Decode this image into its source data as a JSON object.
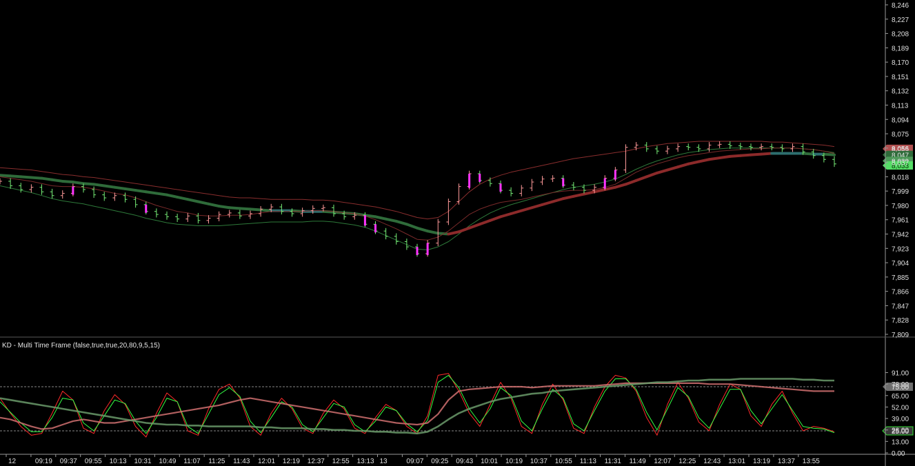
{
  "chart_data": {
    "type": "line",
    "price_panel": {
      "y_ticks": [
        "8,246",
        "8,227",
        "8,208",
        "8,189",
        "8,170",
        "8,151",
        "8,132",
        "8,113",
        "8,094",
        "8,075",
        "8,056",
        "8,037",
        "8,018",
        "7,999",
        "7,980",
        "7,961",
        "7,942",
        "7,923",
        "7,904",
        "7,885",
        "7,866",
        "7,847",
        "7,828",
        "7,809"
      ],
      "ylim": [
        7809,
        8246
      ],
      "last_labels": [
        {
          "text": "8,055",
          "value": 8055,
          "color": "#b05050"
        },
        {
          "text": "8,047",
          "value": 8047,
          "color": "#2f6b3a"
        },
        {
          "text": "8,039",
          "value": 8039,
          "color": "#4e9a5a"
        },
        {
          "text": "8,033",
          "value": 8033,
          "color": "#55dd66"
        }
      ],
      "price_series": [
        8012,
        8006,
        8001,
        8004,
        7998,
        7993,
        7996,
        8005,
        8001,
        7994,
        7990,
        7993,
        7988,
        7981,
        7972,
        7968,
        7965,
        7962,
        7966,
        7960,
        7963,
        7968,
        7970,
        7966,
        7969,
        7975,
        7978,
        7972,
        7969,
        7973,
        7976,
        7977,
        7969,
        7965,
        7967,
        7955,
        7946,
        7939,
        7932,
        7925,
        7916,
        7930,
        7958,
        7985,
        8005,
        8022,
        8013,
        8009,
        8000,
        7996,
        8003,
        8011,
        8015,
        8016,
        8007,
        8004,
        8000,
        8004,
        8016,
        8027,
        8057,
        8060,
        8055,
        8052,
        8055,
        8058,
        8057,
        8055,
        8060,
        8061,
        8059,
        8058,
        8057,
        8058,
        8057,
        8055,
        8058,
        8051,
        8046,
        8041,
        8035
      ],
      "ema_fast": [
        8018,
        8016,
        8014,
        8012,
        8009,
        8006,
        8005,
        8005,
        8004,
        8002,
        7999,
        7996,
        7994,
        7990,
        7985,
        7980,
        7976,
        7972,
        7970,
        7967,
        7966,
        7966,
        7967,
        7967,
        7968,
        7970,
        7972,
        7972,
        7972,
        7972,
        7973,
        7973,
        7972,
        7970,
        7969,
        7966,
        7961,
        7955,
        7949,
        7942,
        7935,
        7934,
        7938,
        7946,
        7957,
        7968,
        7975,
        7980,
        7984,
        7986,
        7988,
        7991,
        7994,
        7997,
        7999,
        8000,
        8000,
        8001,
        8004,
        8008,
        8016,
        8024,
        8030,
        8035,
        8039,
        8043,
        8046,
        8048,
        8050,
        8052,
        8053,
        8054,
        8055,
        8055,
        8056,
        8056,
        8056,
        8055,
        8054,
        8052,
        8049
      ],
      "ema_slow": [
        8020,
        8019,
        8018,
        8017,
        8016,
        8014,
        8012,
        8011,
        8009,
        8008,
        8006,
        8004,
        8002,
        8000,
        7998,
        7996,
        7994,
        7991,
        7988,
        7985,
        7982,
        7979,
        7977,
        7976,
        7975,
        7974,
        7973,
        7973,
        7973,
        7972,
        7972,
        7972,
        7971,
        7970,
        7969,
        7967,
        7965,
        7962,
        7959,
        7955,
        7950,
        7946,
        7943,
        7942,
        7945,
        7950,
        7955,
        7960,
        7965,
        7969,
        7973,
        7977,
        7981,
        7985,
        7989,
        7992,
        7995,
        7998,
        8001,
        8004,
        8008,
        8013,
        8018,
        8023,
        8027,
        8031,
        8035,
        8038,
        8041,
        8043,
        8045,
        8046,
        8047,
        8048,
        8049,
        8049,
        8049,
        8049,
        8048,
        8048,
        8047
      ],
      "upper_band": [
        8030,
        8029,
        8028,
        8027,
        8025,
        8023,
        8021,
        8020,
        8018,
        8017,
        8015,
        8013,
        8011,
        8009,
        8007,
        8005,
        8003,
        8001,
        7999,
        7997,
        7995,
        7993,
        7991,
        7990,
        7990,
        7989,
        7988,
        7988,
        7988,
        7988,
        7987,
        7987,
        7986,
        7984,
        7982,
        7980,
        7978,
        7975,
        7972,
        7968,
        7964,
        7962,
        7964,
        7972,
        7985,
        7998,
        8008,
        8015,
        8020,
        8024,
        8027,
        8030,
        8033,
        8036,
        8039,
        8042,
        8044,
        8046,
        8048,
        8050,
        8052,
        8055,
        8058,
        8060,
        8062,
        8063,
        8064,
        8065,
        8065,
        8065,
        8065,
        8065,
        8065,
        8065,
        8064,
        8064,
        8063,
        8062,
        8061,
        8060,
        8058
      ],
      "lower_band": [
        8006,
        8003,
        8000,
        7997,
        7993,
        7989,
        7986,
        7984,
        7982,
        7979,
        7976,
        7973,
        7970,
        7967,
        7963,
        7960,
        7957,
        7955,
        7954,
        7953,
        7953,
        7953,
        7954,
        7955,
        7956,
        7957,
        7958,
        7958,
        7958,
        7958,
        7959,
        7959,
        7958,
        7956,
        7954,
        7951,
        7946,
        7940,
        7934,
        7928,
        7922,
        7921,
        7925,
        7932,
        7942,
        7953,
        7962,
        7970,
        7976,
        7981,
        7985,
        7989,
        7993,
        7997,
        8001,
        8004,
        8006,
        8008,
        8011,
        8015,
        8021,
        8028,
        8034,
        8039,
        8043,
        8047,
        8050,
        8052,
        8054,
        8055,
        8056,
        8056,
        8056,
        8056,
        8056,
        8056,
        8056,
        8055,
        8054,
        8052,
        8050
      ]
    },
    "oscillator_panel": {
      "title": "KD - Multi Time Frame  (false,true,true,20,80,9,5,15)",
      "y_ticks": [
        "91.00",
        "78.00",
        "65.00",
        "52.00",
        "39.00",
        "26.00",
        "13.00",
        "0.00"
      ],
      "ylim": [
        0,
        100
      ],
      "ref_levels": [
        {
          "text": "75.00",
          "value": 75
        },
        {
          "text": "25.00",
          "value": 25
        }
      ],
      "series": [
        {
          "color": "#ff2a2a",
          "values": [
            62,
            45,
            30,
            20,
            22,
            45,
            70,
            60,
            28,
            22,
            48,
            66,
            55,
            30,
            18,
            45,
            68,
            58,
            25,
            20,
            50,
            72,
            78,
            62,
            30,
            20,
            45,
            62,
            50,
            28,
            22,
            45,
            60,
            50,
            28,
            22,
            40,
            55,
            48,
            30,
            22,
            42,
            88,
            90,
            70,
            45,
            30,
            55,
            80,
            62,
            30,
            22,
            55,
            78,
            60,
            28,
            22,
            52,
            75,
            88,
            85,
            70,
            40,
            20,
            55,
            80,
            62,
            35,
            25,
            55,
            78,
            72,
            42,
            30,
            55,
            70,
            45,
            25,
            30,
            28,
            24
          ]
        },
        {
          "color": "#33ff44",
          "values": [
            58,
            46,
            34,
            24,
            24,
            40,
            62,
            60,
            34,
            25,
            42,
            60,
            56,
            36,
            22,
            40,
            62,
            58,
            30,
            22,
            44,
            66,
            74,
            64,
            36,
            23,
            40,
            58,
            52,
            32,
            24,
            40,
            56,
            52,
            32,
            24,
            36,
            52,
            48,
            33,
            24,
            37,
            80,
            88,
            74,
            50,
            34,
            50,
            74,
            65,
            36,
            25,
            50,
            72,
            62,
            33,
            25,
            48,
            70,
            84,
            84,
            72,
            46,
            26,
            50,
            74,
            64,
            40,
            28,
            50,
            72,
            72,
            48,
            33,
            50,
            66,
            48,
            30,
            28,
            27,
            23
          ]
        },
        {
          "color": "#d07070",
          "values": [
            40,
            38,
            34,
            30,
            27,
            28,
            32,
            36,
            38,
            36,
            34,
            34,
            36,
            38,
            40,
            42,
            44,
            46,
            48,
            50,
            52,
            54,
            57,
            60,
            62,
            60,
            58,
            56,
            54,
            52,
            50,
            48,
            46,
            44,
            42,
            40,
            38,
            36,
            34,
            33,
            32,
            34,
            44,
            60,
            70,
            72,
            73,
            74,
            75,
            75,
            75,
            74,
            75,
            76,
            76,
            76,
            76,
            76,
            77,
            78,
            79,
            79,
            79,
            79,
            79,
            79,
            79,
            79,
            78,
            78,
            78,
            77,
            76,
            75,
            74,
            73,
            72,
            71,
            70,
            70,
            70
          ]
        },
        {
          "color": "#6a9a6a",
          "values": [
            62,
            60,
            58,
            56,
            54,
            52,
            50,
            48,
            46,
            44,
            42,
            40,
            38,
            36,
            34,
            33,
            32,
            32,
            31,
            31,
            30,
            30,
            30,
            30,
            30,
            29,
            29,
            28,
            28,
            28,
            27,
            27,
            26,
            26,
            25,
            25,
            24,
            24,
            23,
            23,
            22,
            24,
            30,
            38,
            45,
            50,
            54,
            58,
            61,
            63,
            65,
            67,
            68,
            70,
            71,
            72,
            73,
            74,
            75,
            76,
            77,
            78,
            79,
            80,
            80,
            81,
            82,
            82,
            83,
            83,
            83,
            84,
            84,
            84,
            84,
            84,
            84,
            83,
            83,
            82,
            82
          ]
        }
      ]
    },
    "x_ticks": [
      "12",
      "09:19",
      "09:37",
      "09:55",
      "10:13",
      "10:31",
      "10:49",
      "11:07",
      "11:25",
      "11:43",
      "12:01",
      "12:19",
      "12:37",
      "12:55",
      "13:13",
      "13",
      "09:07",
      "09:25",
      "09:43",
      "10:01",
      "10:19",
      "10:37",
      "10:55",
      "11:13",
      "11:31",
      "11:49",
      "12:07",
      "12:25",
      "12:43",
      "13:01",
      "13:19",
      "13:37",
      "13:55"
    ],
    "grid": false,
    "legend": "none"
  }
}
